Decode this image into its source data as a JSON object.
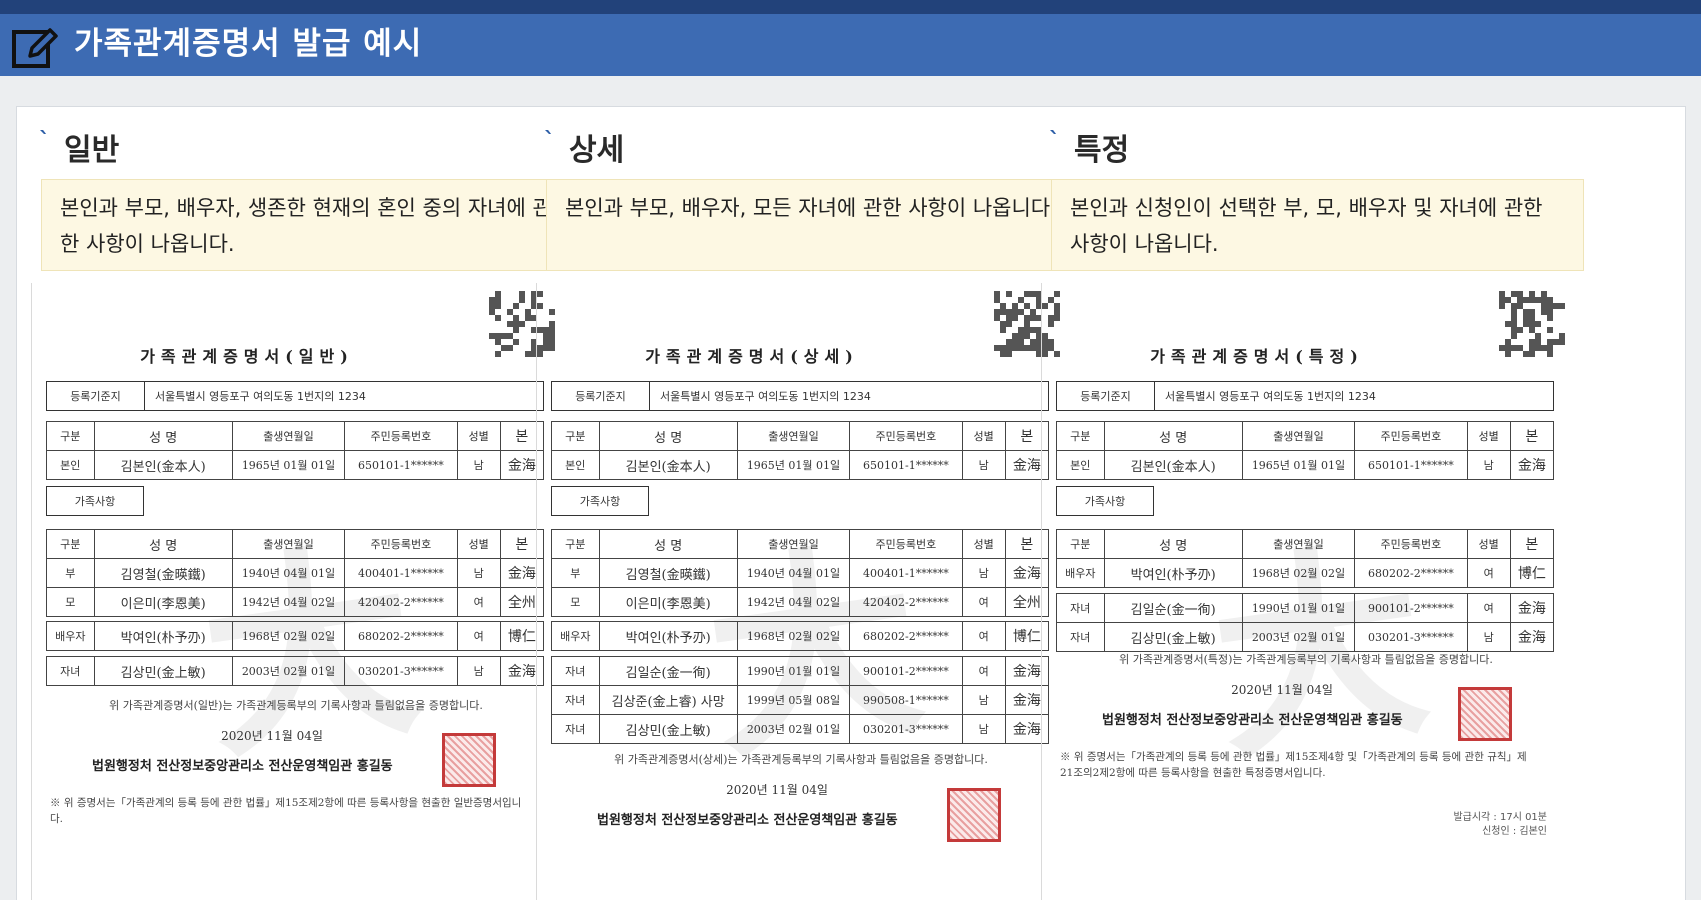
{
  "header": {
    "title": "가족관계증명서 발급 예시"
  },
  "columns": [
    {
      "title": "일반",
      "desc": "본인과 부모, 배우자, 생존한 현재의 혼인 중의 자녀에 관한 사항이 나옵니다.",
      "doc": {
        "title": "가족관계증명서(일반)",
        "reg_label": "등록기준지",
        "reg_value": "서울특별시 영등포구 여의도동 1번지의 1234",
        "headers": [
          "구분",
          "성 명",
          "출생연월일",
          "주민등록번호",
          "성별",
          "본"
        ],
        "self": [
          "본인",
          "김본인(金本人)",
          "1965년 01월 01일",
          "650101-1******",
          "남",
          "金海"
        ],
        "family_label": "가족사항",
        "parents": [
          [
            "부",
            "김영철(金暎鐵)",
            "1940년 04월 01일",
            "400401-1******",
            "남",
            "金海"
          ],
          [
            "모",
            "이은미(李恩美)",
            "1942년 04월 02일",
            "420402-2******",
            "여",
            "全州"
          ]
        ],
        "spouse": [
          [
            "배우자",
            "박여인(朴予刅)",
            "1968년 02월 02일",
            "680202-2******",
            "여",
            "博仁"
          ]
        ],
        "children": [
          [
            "자녀",
            "김상민(金上敏)",
            "2003년 02월 01일",
            "030201-3******",
            "남",
            "金海"
          ]
        ],
        "statement": "위 가족관계증명서(일반)는 가족관계등록부의 기록사항과 틀림없음을 증명합니다.",
        "date": "2020년 11월 04일",
        "issuer": "법원행정처 전산정보중앙관리소 전산운영책임관 홍길동",
        "footer": "※ 위 증명서는「가족관계의 등록 등에 관한 법률」제15조제2항에 따른 등록사항을 현출한 일반증명서입니다."
      }
    },
    {
      "title": "상세",
      "desc": "본인과 부모, 배우자, 모든 자녀에 관한 사항이 나옵니다.",
      "doc": {
        "title": "가족관계증명서(상세)",
        "reg_label": "등록기준지",
        "reg_value": "서울특별시 영등포구 여의도동 1번지의 1234",
        "headers": [
          "구분",
          "성 명",
          "출생연월일",
          "주민등록번호",
          "성별",
          "본"
        ],
        "self": [
          "본인",
          "김본인(金本人)",
          "1965년 01월 01일",
          "650101-1******",
          "남",
          "金海"
        ],
        "family_label": "가족사항",
        "parents": [
          [
            "부",
            "김영철(金暎鐵)",
            "1940년 04월 01일",
            "400401-1******",
            "남",
            "金海"
          ],
          [
            "모",
            "이은미(李恩美)",
            "1942년 04월 02일",
            "420402-2******",
            "여",
            "全州"
          ]
        ],
        "spouse": [
          [
            "배우자",
            "박여인(朴予刅)",
            "1968년 02월 02일",
            "680202-2******",
            "여",
            "博仁"
          ]
        ],
        "children": [
          [
            "자녀",
            "김일순(金一徇)",
            "1990년 01월 01일",
            "900101-2******",
            "여",
            "金海"
          ],
          [
            "자녀",
            "김상준(金上睿) 사망",
            "1999년 05월 08일",
            "990508-1******",
            "남",
            "金海"
          ],
          [
            "자녀",
            "김상민(金上敏)",
            "2003년 02월 01일",
            "030201-3******",
            "남",
            "金海"
          ]
        ],
        "statement": "위 가족관계증명서(상세)는 가족관계등록부의 기록사항과 틀림없음을 증명합니다.",
        "date": "2020년 11월 04일",
        "issuer": "법원행정처 전산정보중앙관리소 전산운영책임관 홍길동",
        "footer": ""
      }
    },
    {
      "title": "특정",
      "desc": "본인과 신청인이 선택한 부, 모, 배우자 및 자녀에 관한 사항이 나옵니다.",
      "doc": {
        "title": "가족관계증명서(특정)",
        "reg_label": "등록기준지",
        "reg_value": "서울특별시 영등포구 여의도동 1번지의 1234",
        "headers": [
          "구분",
          "성 명",
          "출생연월일",
          "주민등록번호",
          "성별",
          "본"
        ],
        "self": [
          "본인",
          "김본인(金本人)",
          "1965년 01월 01일",
          "650101-1******",
          "남",
          "金海"
        ],
        "family_label": "가족사항",
        "parents": [],
        "spouse": [
          [
            "배우자",
            "박여인(朴予刅)",
            "1968년 02월 02일",
            "680202-2******",
            "여",
            "博仁"
          ]
        ],
        "children": [
          [
            "자녀",
            "김일순(金一徇)",
            "1990년 01월 01일",
            "900101-2******",
            "여",
            "金海"
          ],
          [
            "자녀",
            "김상민(金上敏)",
            "2003년 02월 01일",
            "030201-3******",
            "남",
            "金海"
          ]
        ],
        "statement": "위 가족관계증명서(특정)는 가족관계등록부의 기록사항과 틀림없음을 증명합니다.",
        "date": "2020년 11월 04일",
        "issuer": "법원행정처 전산정보중앙관리소 전산운영책임관 홍길동",
        "footer": "※ 위 증명서는「가족관계의 등록 등에 관한 법률」제15조제4항 및「가족관계의 등록 등에 관한 규칙」제21조의2제2항에 따른 등록사항을 현출한 특정증명서입니다.",
        "issue_time": "발급시각 : 17시 01분",
        "applicant": "신청인 : 김본인"
      }
    }
  ]
}
